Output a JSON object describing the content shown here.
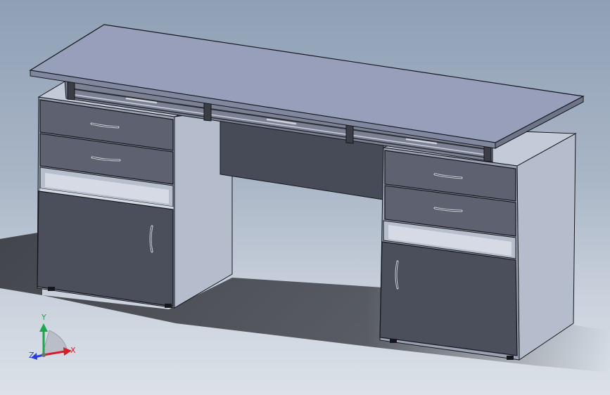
{
  "viewport": {
    "background_top": "#8fa0b6",
    "background_bottom": "#dde2e9"
  },
  "model": {
    "colors": {
      "top_surface": "#989fbb",
      "top_edge": "#80879f",
      "cabinet_side": "#b5bdcc",
      "cabinet_front": "#8f97aa",
      "drawer_front": "#5d6170",
      "door_front": "#4b4f5b",
      "modesty_panel": "#464b57",
      "shadow": "#1e1f24",
      "outline": "#15171c"
    }
  },
  "triad": {
    "icon": "coordinate-triad-icon",
    "x_label": "X",
    "y_label": "Y",
    "z_label": "Z",
    "x_color": "#d4202a",
    "y_color": "#1aa84a",
    "z_color": "#2a3fd0"
  }
}
